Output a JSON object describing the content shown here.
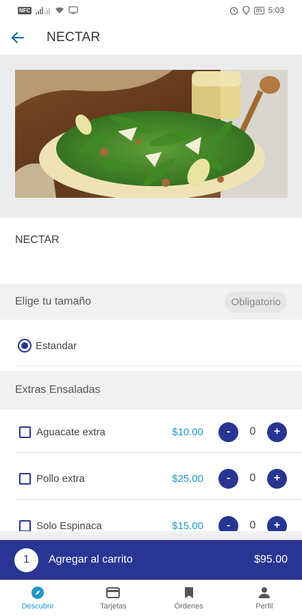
{
  "status_bar": {
    "nfc": "NFC",
    "time": "5:03",
    "battery": "85"
  },
  "app_bar": {
    "title": "NECTAR"
  },
  "product": {
    "name": "NECTAR",
    "image_icon": "salad-photo"
  },
  "size_section": {
    "title": "Elige tu tamaño",
    "required_label": "Obligatorio",
    "options": [
      {
        "label": "Estandar",
        "selected": true
      }
    ]
  },
  "extras_section": {
    "title": "Extras Ensaladas",
    "items": [
      {
        "label": "Aguacate extra",
        "price": "$10.00",
        "qty": "0",
        "checked": false
      },
      {
        "label": "Pollo extra",
        "price": "$25.00",
        "qty": "0",
        "checked": false
      },
      {
        "label": "Solo Espinaca",
        "price": "$15.00",
        "qty": "0",
        "checked": false
      }
    ],
    "minus_label": "-",
    "plus_label": "+"
  },
  "cart": {
    "count": "1",
    "label": "Agregar al carrito",
    "total": "$95.00"
  },
  "bottom_nav": {
    "items": [
      {
        "label": "Descubrir",
        "icon": "compass-icon",
        "active": true
      },
      {
        "label": "Tarjetas",
        "icon": "card-icon",
        "active": false
      },
      {
        "label": "Órdenes",
        "icon": "bookmark-icon",
        "active": false
      },
      {
        "label": "Perfil",
        "icon": "person-icon",
        "active": false
      }
    ]
  },
  "colors": {
    "primary": "#283593",
    "accent": "#2196c9",
    "back_arrow": "#1a6fa3"
  }
}
